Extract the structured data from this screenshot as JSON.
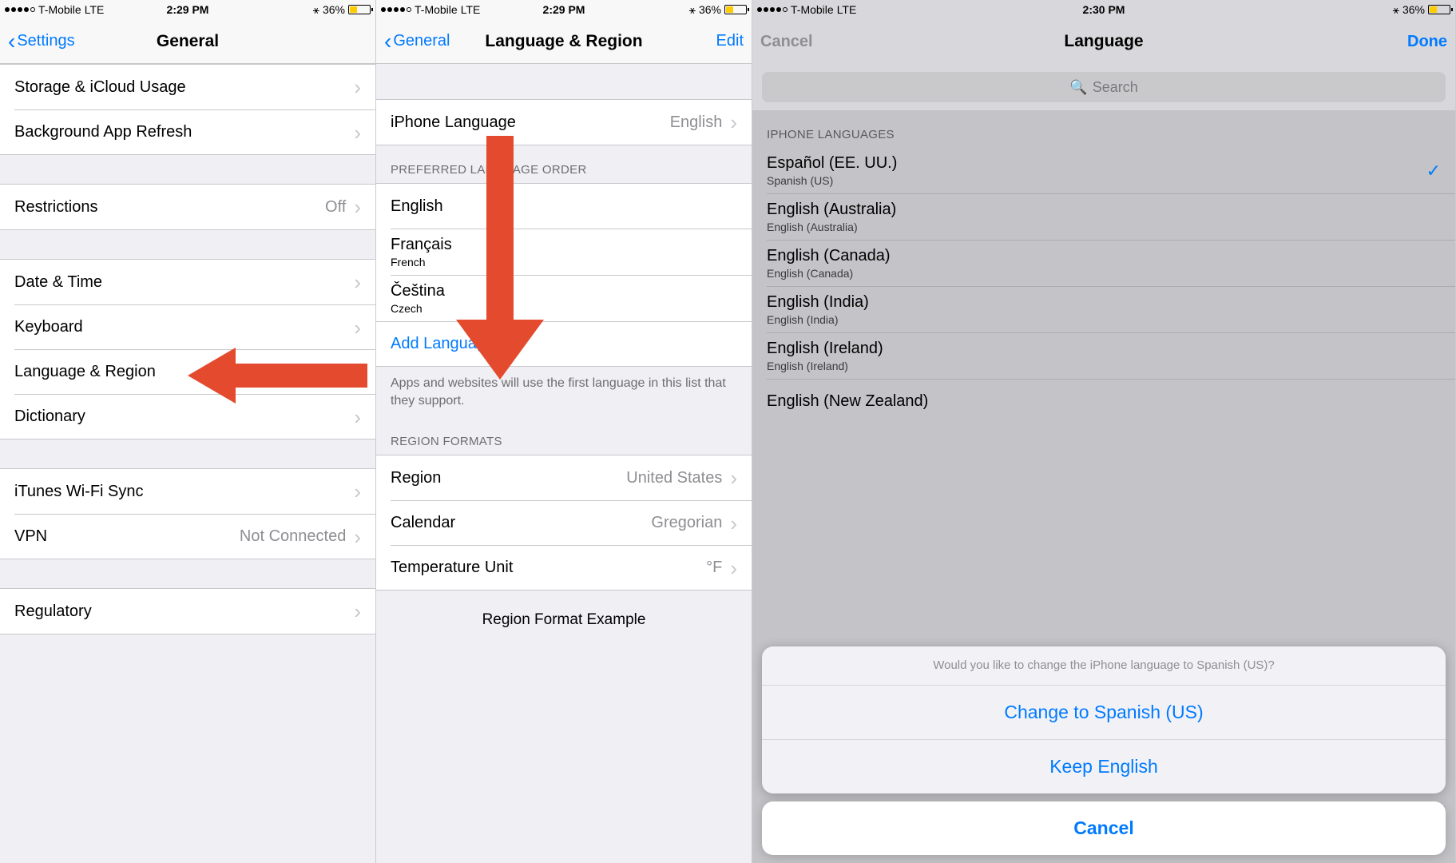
{
  "screen1": {
    "status": {
      "carrier": "T-Mobile",
      "net": "LTE",
      "time": "2:29 PM",
      "battery": "36%"
    },
    "nav": {
      "back": "Settings",
      "title": "General"
    },
    "rows": {
      "storage": "Storage & iCloud Usage",
      "bgrefresh": "Background App Refresh",
      "restrictions": "Restrictions",
      "restrictions_val": "Off",
      "datetime": "Date & Time",
      "keyboard": "Keyboard",
      "langregion": "Language & Region",
      "dictionary": "Dictionary",
      "ituneswifi": "iTunes Wi-Fi Sync",
      "vpn": "VPN",
      "vpn_val": "Not Connected",
      "regulatory": "Regulatory"
    }
  },
  "screen2": {
    "status": {
      "carrier": "T-Mobile",
      "net": "LTE",
      "time": "2:29 PM",
      "battery": "36%"
    },
    "nav": {
      "back": "General",
      "title": "Language & Region",
      "right": "Edit"
    },
    "iphone_lang": {
      "label": "iPhone Language",
      "value": "English"
    },
    "preferred_header": "PREFERRED LANGUAGE ORDER",
    "preferred": [
      {
        "name": "English",
        "sub": ""
      },
      {
        "name": "Français",
        "sub": "French"
      },
      {
        "name": "Čeština",
        "sub": "Czech"
      }
    ],
    "add_language": "Add Language…",
    "preferred_footer": "Apps and websites will use the first language in this list that they support.",
    "region_header": "REGION FORMATS",
    "region_rows": {
      "region": "Region",
      "region_val": "United States",
      "calendar": "Calendar",
      "calendar_val": "Gregorian",
      "temp": "Temperature Unit",
      "temp_val": "°F"
    },
    "example_header": "Region Format Example"
  },
  "screen3": {
    "status": {
      "carrier": "T-Mobile",
      "net": "LTE",
      "time": "2:30 PM",
      "battery": "36%"
    },
    "nav": {
      "left": "Cancel",
      "title": "Language",
      "right": "Done"
    },
    "search_placeholder": "Search",
    "list_header": "IPHONE LANGUAGES",
    "languages": [
      {
        "name": "Español (EE. UU.)",
        "sub": "Spanish (US)",
        "checked": true
      },
      {
        "name": "English (Australia)",
        "sub": "English (Australia)"
      },
      {
        "name": "English (Canada)",
        "sub": "English (Canada)"
      },
      {
        "name": "English (India)",
        "sub": "English (India)"
      },
      {
        "name": "English (Ireland)",
        "sub": "English (Ireland)"
      },
      {
        "name": "English (New Zealand)",
        "sub": ""
      }
    ],
    "sheet": {
      "title": "Would you like to change the iPhone language to Spanish (US)?",
      "change": "Change to Spanish (US)",
      "keep": "Keep English",
      "cancel": "Cancel"
    }
  }
}
